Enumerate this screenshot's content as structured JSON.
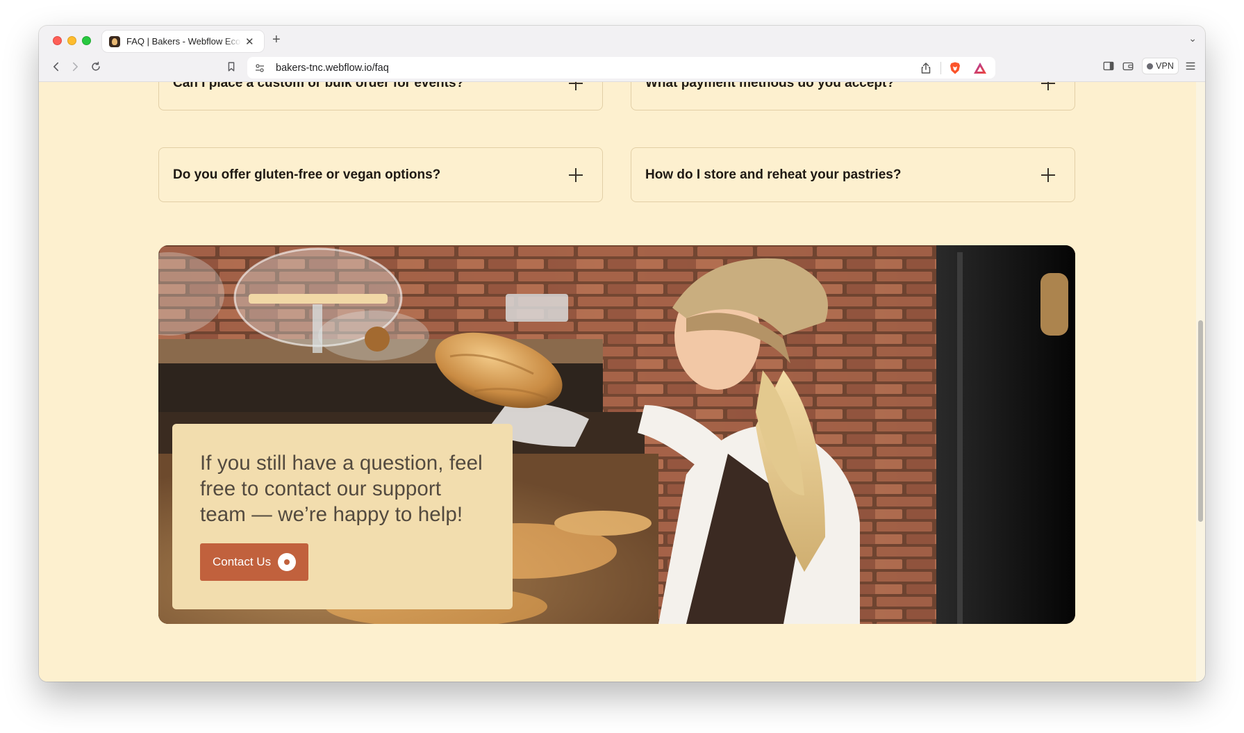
{
  "browser": {
    "tab_title": "FAQ | Bakers - Webflow Ecommerce",
    "url": "bakers-tnc.webflow.io/faq",
    "vpn_label": "VPN"
  },
  "faq": {
    "items": [
      {
        "question": "Can I place a custom or bulk order for events?"
      },
      {
        "question": "What payment methods do you accept?"
      },
      {
        "question": "Do you offer gluten-free or vegan options?"
      },
      {
        "question": "How do I store and reheat your pastries?"
      }
    ]
  },
  "cta": {
    "text": "If you still have a question, feel free to contact our support team — we’re happy to help!",
    "button_label": "Contact Us"
  },
  "colors": {
    "page_background": "#fdf0cf",
    "card_background": "#f2ddae",
    "button": "#c1613d"
  }
}
